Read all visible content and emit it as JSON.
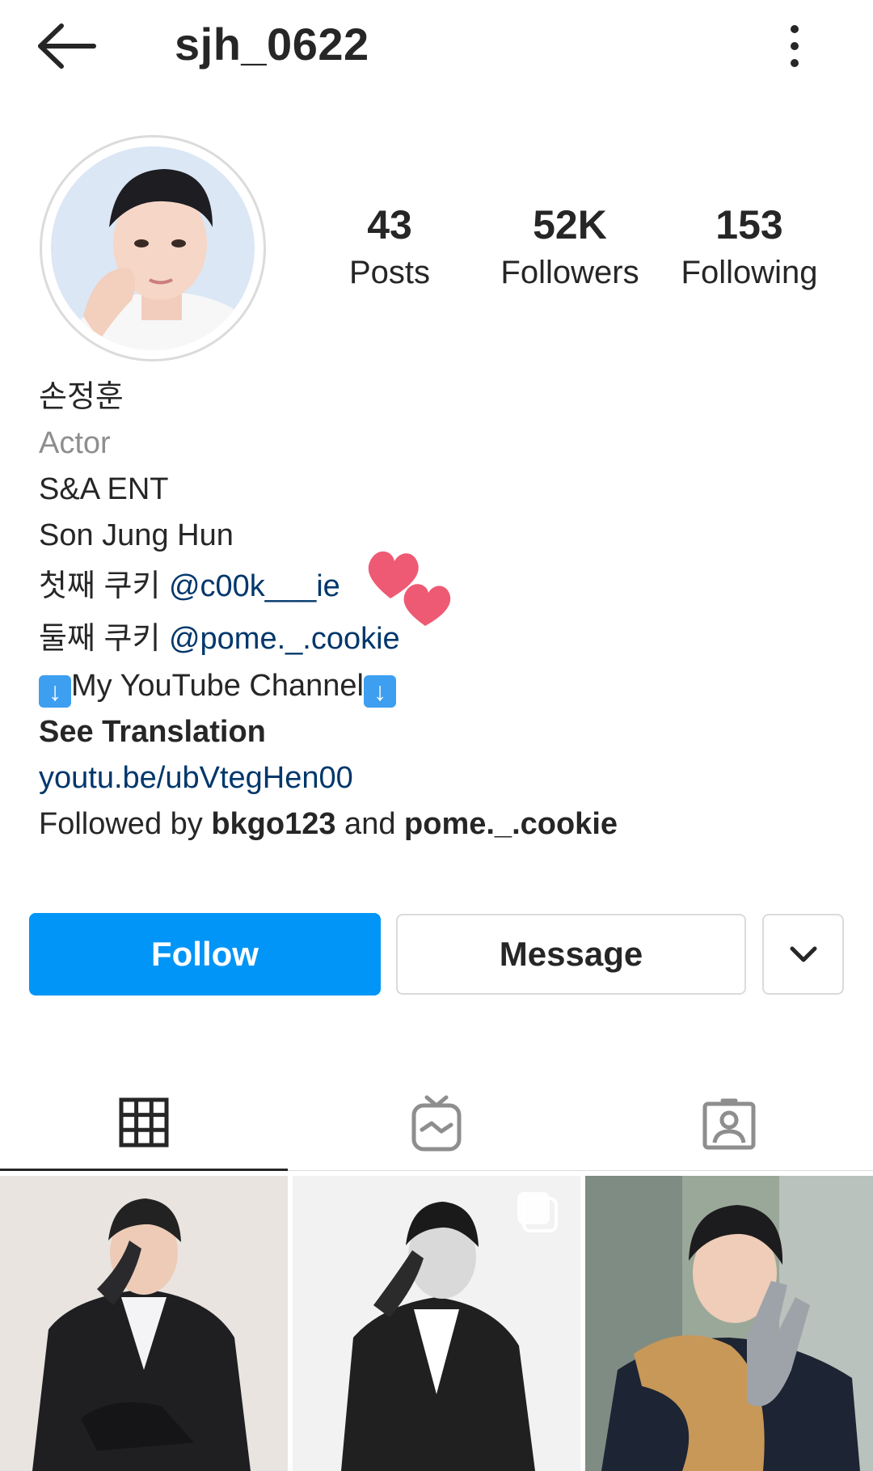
{
  "header": {
    "username": "sjh_0622",
    "back_icon": "arrow-left-icon",
    "more_icon": "more-vertical-icon"
  },
  "stats": [
    {
      "value": "43",
      "label": "Posts"
    },
    {
      "value": "52K",
      "label": "Followers"
    },
    {
      "value": "153",
      "label": "Following"
    }
  ],
  "bio": {
    "name": "손정훈",
    "category": "Actor",
    "line1": "S&A ENT",
    "line2": "Son Jung Hun",
    "cookie1_prefix": "첫째 쿠키 ",
    "cookie1_mention": "@c00k___ie",
    "cookie2_prefix": "둘째 쿠키 ",
    "cookie2_mention": "@pome._.cookie",
    "youtube_line": "My YouTube Channel",
    "see_translation": "See Translation",
    "link": "youtu.be/ubVtegHen00",
    "followed_prefix": "Followed by ",
    "followed_user1": "bkgo123",
    "followed_and": " and ",
    "followed_user2": "pome._.cookie"
  },
  "actions": {
    "follow_label": "Follow",
    "message_label": "Message",
    "dropdown_icon": "chevron-down-icon"
  },
  "tabs": [
    {
      "icon": "grid-icon",
      "active": true
    },
    {
      "icon": "igtv-icon",
      "active": false
    },
    {
      "icon": "tagged-user-icon",
      "active": false
    }
  ],
  "colors": {
    "follow_button": "#0095f6",
    "link": "#00376b",
    "secondary_text": "#8e8e8e",
    "border": "#dbdbdb",
    "heart": "#ee5a73"
  }
}
